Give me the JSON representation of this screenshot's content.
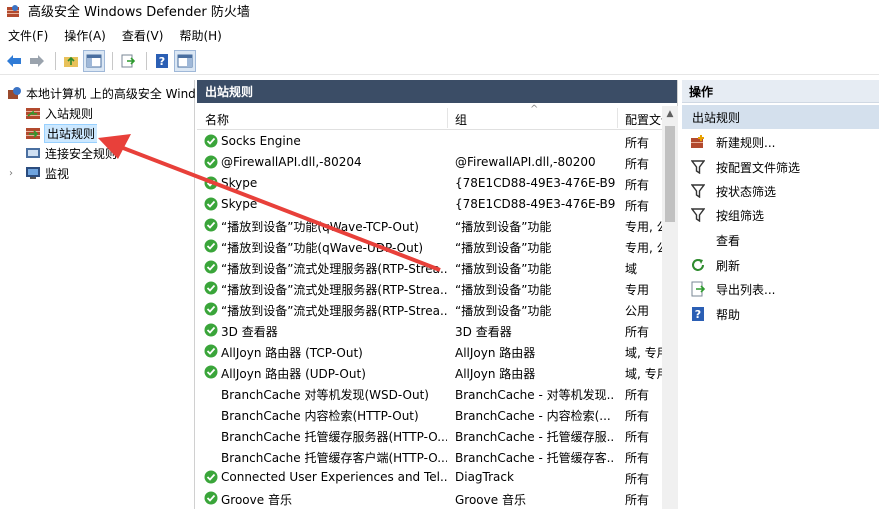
{
  "window": {
    "title": "高级安全 Windows Defender 防火墙"
  },
  "menu": [
    "文件(F)",
    "操作(A)",
    "查看(V)",
    "帮助(H)"
  ],
  "toolbar": {
    "buttons": [
      "back-icon",
      "forward-icon",
      "folder-up-icon",
      "show-hide-tree-icon",
      "export-icon",
      "help-icon",
      "show-hide-action-pane-icon"
    ]
  },
  "tree": {
    "root": "本地计算机 上的高级安全 Windows Defender 防火墙",
    "items": [
      "入站规则",
      "出站规则",
      "连接安全规则",
      "监视"
    ]
  },
  "center": {
    "title": "出站规则",
    "columns": [
      "名称",
      "组",
      "配置文件"
    ],
    "rows": [
      {
        "name": "Socks Engine",
        "group": "",
        "profile": "所有",
        "enabled": true
      },
      {
        "name": "@FirewallAPI.dll,-80204",
        "group": "@FirewallAPI.dll,-80200",
        "profile": "所有",
        "enabled": true
      },
      {
        "name": "Skype",
        "group": "{78E1CD88-49E3-476E-B9...",
        "profile": "所有",
        "enabled": true
      },
      {
        "name": "Skype",
        "group": "{78E1CD88-49E3-476E-B9...",
        "profile": "所有",
        "enabled": true
      },
      {
        "name": "“播放到设备”功能(qWave-TCP-Out)",
        "group": "“播放到设备”功能",
        "profile": "专用, 公",
        "enabled": true
      },
      {
        "name": "“播放到设备”功能(qWave-UDP-Out)",
        "group": "“播放到设备”功能",
        "profile": "专用, 公",
        "enabled": true
      },
      {
        "name": "“播放到设备”流式处理服务器(RTP-Strea...",
        "group": "“播放到设备”功能",
        "profile": "域",
        "enabled": true
      },
      {
        "name": "“播放到设备”流式处理服务器(RTP-Strea...",
        "group": "“播放到设备”功能",
        "profile": "专用",
        "enabled": true
      },
      {
        "name": "“播放到设备”流式处理服务器(RTP-Strea...",
        "group": "“播放到设备”功能",
        "profile": "公用",
        "enabled": true
      },
      {
        "name": "3D 查看器",
        "group": "3D 查看器",
        "profile": "所有",
        "enabled": true
      },
      {
        "name": "AllJoyn 路由器 (TCP-Out)",
        "group": "AllJoyn 路由器",
        "profile": "域, 专用",
        "enabled": true
      },
      {
        "name": "AllJoyn 路由器 (UDP-Out)",
        "group": "AllJoyn 路由器",
        "profile": "域, 专用",
        "enabled": true
      },
      {
        "name": "BranchCache 对等机发现(WSD-Out)",
        "group": "BranchCache - 对等机发现...",
        "profile": "所有",
        "enabled": false
      },
      {
        "name": "BranchCache 内容检索(HTTP-Out)",
        "group": "BranchCache - 内容检索(...",
        "profile": "所有",
        "enabled": false
      },
      {
        "name": "BranchCache 托管缓存服务器(HTTP-O...",
        "group": "BranchCache - 托管缓存服...",
        "profile": "所有",
        "enabled": false
      },
      {
        "name": "BranchCache 托管缓存客户端(HTTP-O...",
        "group": "BranchCache - 托管缓存客...",
        "profile": "所有",
        "enabled": false
      },
      {
        "name": "Connected User Experiences and Tel...",
        "group": "DiagTrack",
        "profile": "所有",
        "enabled": true
      },
      {
        "name": "Groove 音乐",
        "group": "Groove 音乐",
        "profile": "所有",
        "enabled": true
      }
    ]
  },
  "actions": {
    "title": "操作",
    "section": "出站规则",
    "items": [
      {
        "label": "新建规则...",
        "icon": "new-rule-icon"
      },
      {
        "label": "按配置文件筛选",
        "icon": "filter-icon"
      },
      {
        "label": "按状态筛选",
        "icon": "filter-icon"
      },
      {
        "label": "按组筛选",
        "icon": "filter-icon"
      },
      {
        "label": "查看",
        "icon": ""
      },
      {
        "label": "刷新",
        "icon": "refresh-icon"
      },
      {
        "label": "导出列表...",
        "icon": "export-icon"
      },
      {
        "label": "帮助",
        "icon": "help-icon"
      }
    ]
  },
  "colors": {
    "pane_header": "#3b4d66",
    "annotation_arrow": "#e8403a",
    "enabled_check": "#3aa53a"
  }
}
